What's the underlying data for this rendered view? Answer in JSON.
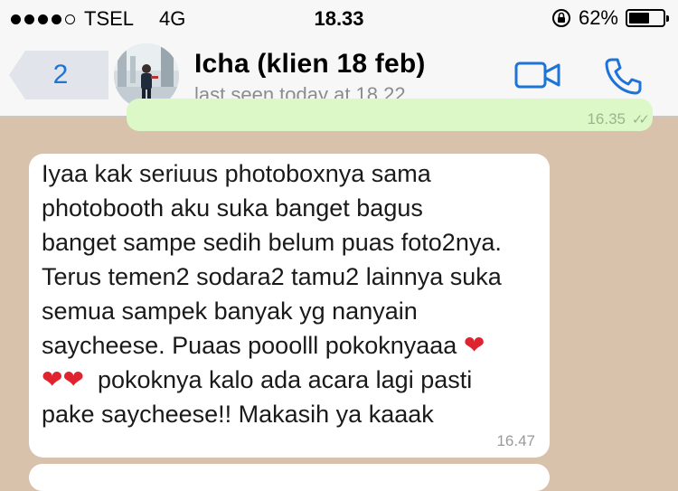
{
  "status_bar": {
    "carrier": "TSEL",
    "network": "4G",
    "time": "18.33",
    "battery_percent": "62%",
    "battery_level": 0.62
  },
  "nav": {
    "back_count": "2",
    "contact_name": "Icha (klien 18 feb)",
    "contact_status": "last seen today at 18.22",
    "video_icon": "video-camera-icon",
    "call_icon": "phone-icon"
  },
  "chat": {
    "outgoing_time": "16.35",
    "incoming": {
      "lines": [
        "Iyaa kak seriuus photoboxnya sama",
        "photobooth aku suka banget bagus",
        "banget sampe sedih belum puas foto2nya.",
        "Terus temen2 sodara2 tamu2 lainnya suka",
        "semua sampek banyak yg nanyain",
        "saycheese. Puaas pooolll pokoknyaaa",
        "pokoknya kalo ada acara lagi pasti",
        "pake saycheese!! Makasih ya kaaak"
      ],
      "time": "16.47"
    }
  },
  "colors": {
    "chat_background": "#d9c2ac",
    "outgoing_bubble": "#dcf8c6",
    "accent_blue": "#1e73d6",
    "heart_red": "#e0242f"
  }
}
